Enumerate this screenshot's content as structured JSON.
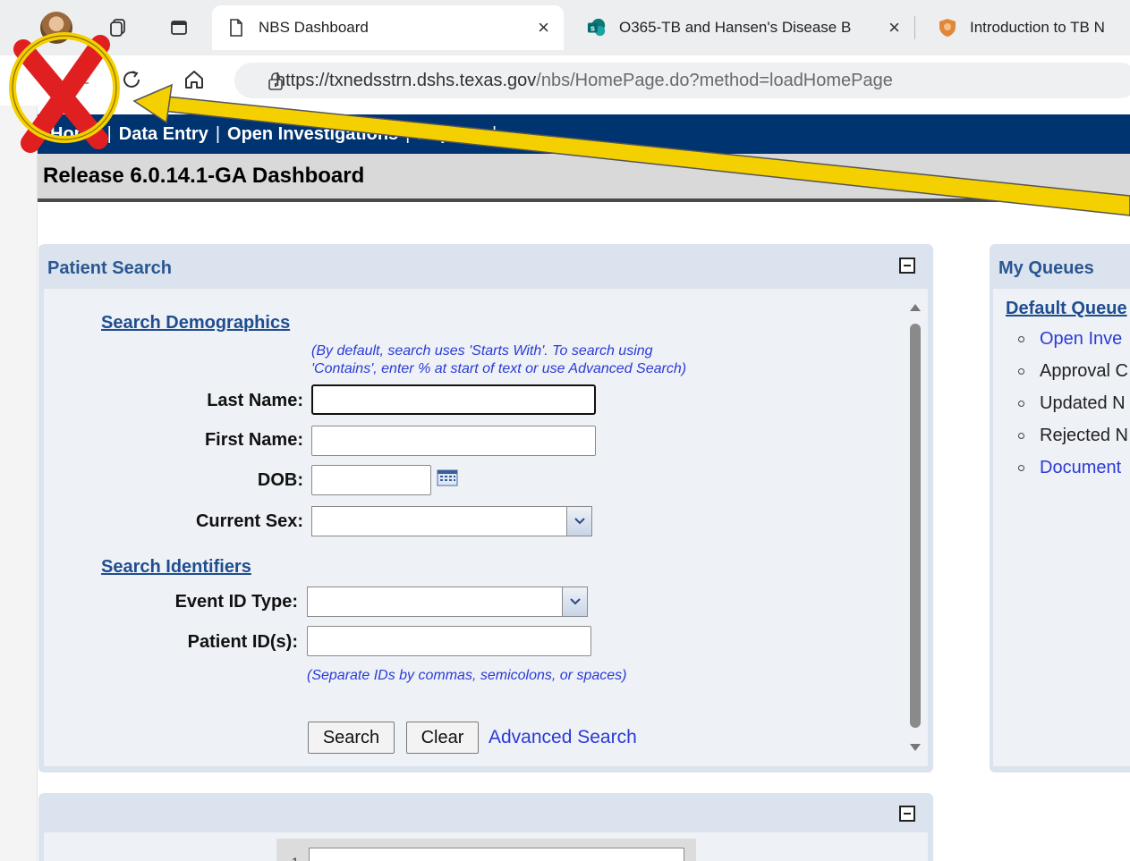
{
  "browser": {
    "tabs": [
      {
        "title": "NBS Dashboard",
        "active": true,
        "close": "×"
      },
      {
        "title": "O365-TB and Hansen's Disease B",
        "active": false,
        "close": "×"
      },
      {
        "title": "Introduction to TB N",
        "active": false
      }
    ],
    "url": {
      "host": "https://txnedsstrn.dshs.texas.gov",
      "path": "/nbs/HomePage.do?method=loadHomePage"
    }
  },
  "app": {
    "menu": [
      "Home",
      "Data Entry",
      "Open Investigations",
      "Reports"
    ],
    "menu_separator": "|",
    "page_title": "Release 6.0.14.1-GA Dashboard"
  },
  "patient_search": {
    "title": "Patient Search",
    "search_demographics_label": "Search Demographics",
    "hint_line1": "(By default, search uses 'Starts With'. To search using",
    "hint_line2": "'Contains', enter % at start of text or use Advanced Search)",
    "last_name_label": "Last Name:",
    "last_name_value": "",
    "first_name_label": "First Name:",
    "first_name_value": "",
    "dob_label": "DOB:",
    "dob_value": "",
    "current_sex_label": "Current Sex:",
    "current_sex_value": "",
    "search_identifiers_label": "Search Identifiers",
    "event_id_type_label": "Event ID Type:",
    "event_id_type_value": "",
    "patient_ids_label": "Patient ID(s):",
    "patient_ids_value": "",
    "ids_hint": "(Separate IDs by commas, semicolons, or spaces)",
    "search_button": "Search",
    "clear_button": "Clear",
    "advanced_search_link": "Advanced Search"
  },
  "my_queues": {
    "title": "My Queues",
    "default_queue_label": "Default Queue",
    "items": [
      {
        "label": "Open Inve",
        "link": true
      },
      {
        "label": "Approval C",
        "link": false
      },
      {
        "label": "Updated N",
        "link": false
      },
      {
        "label": "Rejected N",
        "link": false
      },
      {
        "label": "Document",
        "link": true
      }
    ]
  },
  "second_panel": {
    "row_number": "1"
  },
  "colors": {
    "app_menu_bg": "#003470",
    "panel_title": "#2a5793",
    "link_blue": "#2b3bd6",
    "annotation_red": "#e02020",
    "annotation_yellow": "#f5d000"
  }
}
